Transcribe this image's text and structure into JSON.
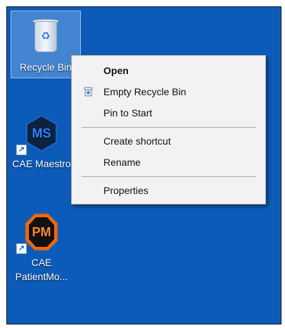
{
  "desktop": {
    "background_color": "#0d5bb8",
    "icons": [
      {
        "label": "Recycle Bin",
        "icon": "recycle-bin-icon",
        "selected": true
      },
      {
        "label": "CAE Maestro",
        "badge": "MS",
        "icon": "cae-maestro-app-icon",
        "color": "#0b2340"
      },
      {
        "label_line1": "CAE",
        "label_line2": "PatientMo...",
        "badge": "PM",
        "icon": "cae-patient-monitor-app-icon",
        "color": "#ef6b12"
      }
    ]
  },
  "context_menu": {
    "items": [
      {
        "label": "Open",
        "bold": true
      },
      {
        "label": "Empty Recycle Bin",
        "icon": "recycle-bin-small-icon"
      },
      {
        "label": "Pin to Start"
      },
      {
        "label": "Create shortcut"
      },
      {
        "label": "Rename"
      },
      {
        "label": "Properties"
      }
    ]
  }
}
